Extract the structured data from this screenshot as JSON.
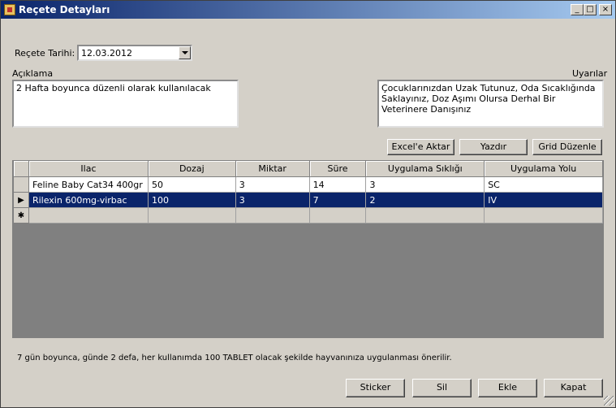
{
  "window": {
    "title": "Reçete Detayları",
    "minimize_glyph": "_",
    "maximize_glyph": "□",
    "close_glyph": "×"
  },
  "form": {
    "date_label": "Reçete Tarihi:",
    "date_value": "12.03.2012",
    "description_label": "Açıklama",
    "description_value": "2 Hafta boyunca düzenli olarak kullanılacak",
    "warnings_label": "Uyarılar",
    "warnings_value": "Çocuklarınızdan Uzak Tutunuz, Oda Sıcaklığında Saklayınız, Doz Aşımı Olursa Derhal Bir Veterinere Danışınız"
  },
  "toolbar": {
    "excel_label": "Excel'e Aktar",
    "print_label": "Yazdır",
    "grid_edit_label": "Grid Düzenle"
  },
  "grid": {
    "columns": [
      "Ilac",
      "Dozaj",
      "Miktar",
      "Süre",
      "Uygulama Sıklığı",
      "Uygulama Yolu"
    ],
    "rows": [
      [
        "Feline Baby Cat34 400gr",
        "50",
        "3",
        "14",
        "3",
        "SC"
      ],
      [
        "Rilexin 600mg-virbac",
        "100",
        "3",
        "7",
        "2",
        "IV"
      ]
    ],
    "selected_row_marker": "▶",
    "new_row_marker": "✱"
  },
  "summary": "7 gün boyunca, günde 2 defa, her kullanımda 100 TABLET olacak şekilde hayvanınıza uygulanması önerilir.",
  "actions": {
    "sticker_label": "Sticker",
    "delete_label": "Sil",
    "add_label": "Ekle",
    "close_label": "Kapat"
  }
}
